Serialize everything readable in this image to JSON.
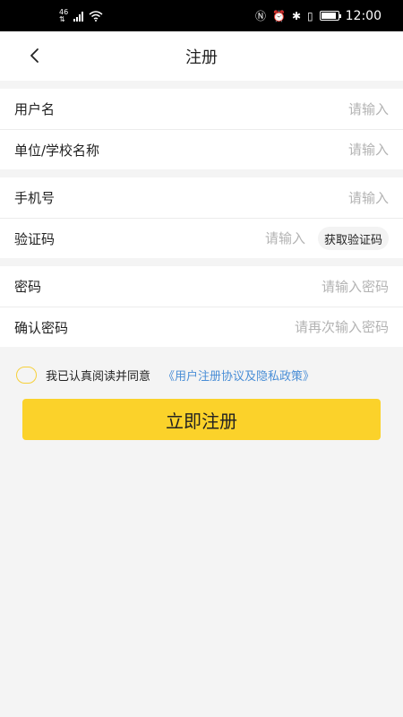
{
  "status_bar": {
    "network": "46",
    "time": "12:00"
  },
  "nav": {
    "title": "注册"
  },
  "groups": [
    {
      "rows": [
        {
          "label": "用户名",
          "placeholder": "请输入"
        },
        {
          "label": "单位/学校名称",
          "placeholder": "请输入"
        }
      ]
    },
    {
      "rows": [
        {
          "label": "手机号",
          "placeholder": "请输入"
        },
        {
          "label": "验证码",
          "placeholder": "请输入",
          "button": "获取验证码"
        }
      ]
    },
    {
      "rows": [
        {
          "label": "密码",
          "placeholder": "请输入密码"
        },
        {
          "label": "确认密码",
          "placeholder": "请再次输入密码"
        }
      ]
    }
  ],
  "agreement": {
    "text": "我已认真阅读并同意",
    "link": "《用户注册协议及隐私政策》",
    "checked": false
  },
  "submit": {
    "label": "立即注册"
  },
  "colors": {
    "accent": "#fbd22a",
    "link": "#4a8ed6",
    "placeholder": "#b3b3b3"
  }
}
